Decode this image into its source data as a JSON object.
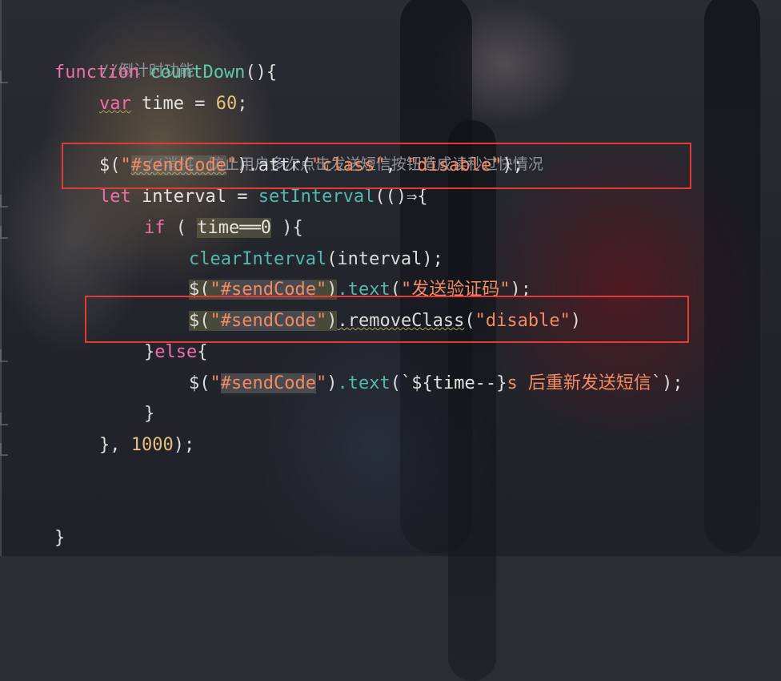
{
  "code": {
    "l1": {
      "comment": "//倒计时功能"
    },
    "l2": {
      "kw": "function",
      "name": "countDown",
      "rest": "(){"
    },
    "l3": {
      "kw": "var",
      "name": "time",
      "op": " = ",
      "num": "60",
      "end": ";"
    },
    "l4": {
      "comment": "//消抖，防止用户多次点击发送短信按钮造成读秒过快情况"
    },
    "l5": {
      "dollar": "$(",
      "q1": "\"",
      "sel": "#sendCode",
      "q2": "\"",
      "close": ")",
      "method": ".attr(",
      "a1": "\"class\"",
      "comma": ", ",
      "a2": "\"disable\"",
      "end": ");"
    },
    "l6": {
      "kw": "let",
      "name": " interval = ",
      "fn": "setInterval",
      "rest": "(()⇒{"
    },
    "l7": {
      "kw": "if",
      "open": " ( ",
      "cond": "time══0",
      "close": " ){"
    },
    "l8": {
      "fn": "clearInterval",
      "rest": "(interval);"
    },
    "l9": {
      "dollar": "$(",
      "q1": "\"",
      "sel": "#sendCode",
      "q2": "\"",
      "close": ")",
      "method": ".text",
      "paren": "(",
      "arg": "\"发送验证码\"",
      "end": ");"
    },
    "l10": {
      "dollar": "$(",
      "q1": "\"",
      "sel": "#sendCode",
      "q2": "\"",
      "close": ")",
      "method": ".removeClass",
      "paren": "(",
      "arg": "\"disable\"",
      "end": ")"
    },
    "l11": {
      "close": "}",
      "kw": "else",
      "open": "{"
    },
    "l12": {
      "dollar": "$(",
      "q1": "\"",
      "sel": "#sendCode",
      "q2": "\"",
      "close": ")",
      "method": ".text",
      "paren": "(`",
      "tpl1": "${",
      "tplvar": "time--",
      "tpl2": "}",
      "tplstr": "s 后重新发送短信",
      "end": "`);"
    },
    "l13": {
      "text": "}"
    },
    "l14": {
      "text": "}, ",
      "num": "1000",
      "end": ");"
    },
    "l15": {
      "text": "}"
    }
  }
}
